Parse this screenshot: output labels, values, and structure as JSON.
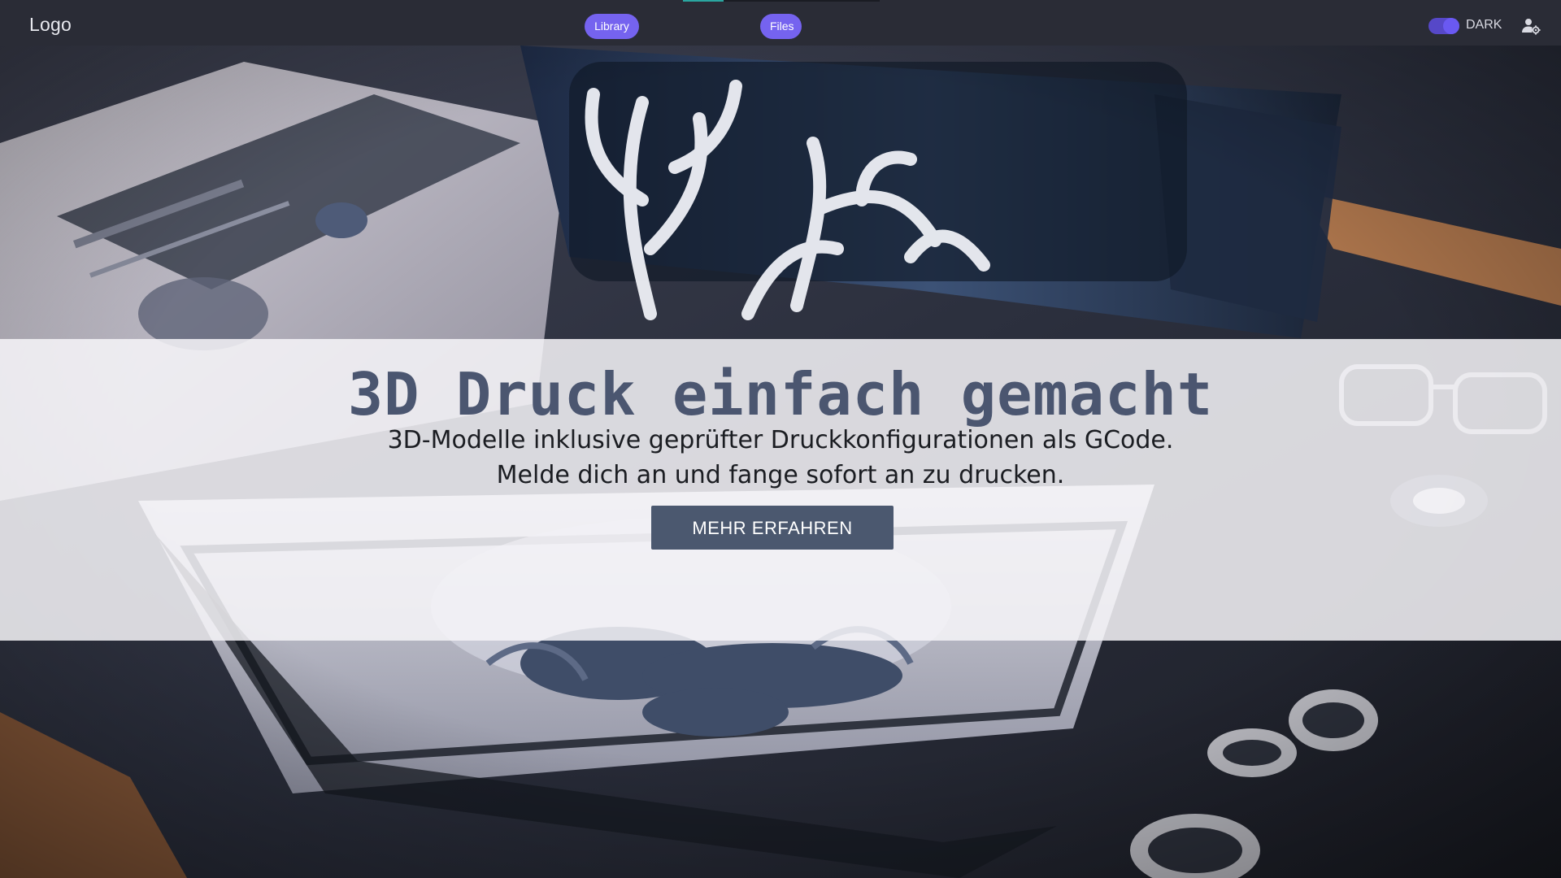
{
  "nav": {
    "logo": "Logo",
    "links": [
      {
        "label": "Library",
        "active": true
      },
      {
        "label": "Files"
      }
    ],
    "theme_toggle": {
      "label": "DARK",
      "enabled": true
    },
    "user_settings_icon": "user-settings-icon",
    "accent_color": "#7563ef"
  },
  "hero": {
    "title": "3D Druck einfach gemacht",
    "subtitle_line1": "3D-Modelle inklusive geprüfter Druckkonfigurationen als GCode.",
    "subtitle_line2": "Melde dich an und fange sofort an zu drucken.",
    "cta_label": "MEHR ERFAHREN",
    "title_color": "#4b5670",
    "cta_color": "#4b586f"
  }
}
